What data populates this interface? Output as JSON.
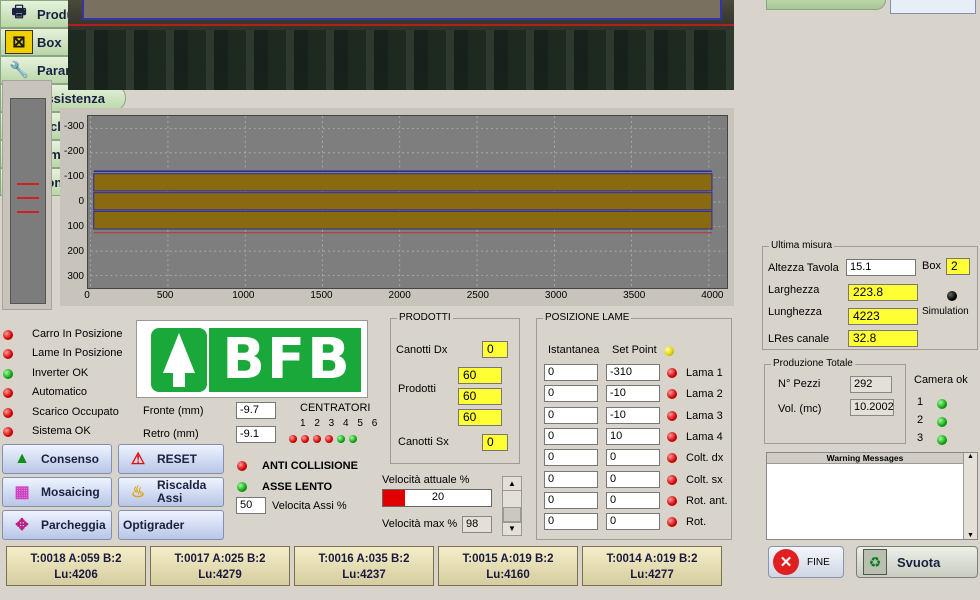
{
  "menu": [
    {
      "label": "Produzione",
      "icon": "printer-icon"
    },
    {
      "label": "Box",
      "icon": "box-icon"
    },
    {
      "label": "Parametri",
      "icon": "wrench-icon"
    },
    {
      "label": "Assistenza",
      "icon": "computer-icon"
    },
    {
      "label": "Ciclo",
      "icon": "list-icon"
    },
    {
      "label": "Simulazione",
      "icon": "ruler-icon"
    },
    {
      "label": "Controllo",
      "icon": "camera-icon"
    }
  ],
  "plot": {
    "y_ticks": [
      "-300",
      "-200",
      "-100",
      "0",
      "100",
      "200",
      "300"
    ],
    "x_ticks": [
      "0",
      "500",
      "1000",
      "1500",
      "2000",
      "2500",
      "3000",
      "3500",
      "4000"
    ],
    "colors": {
      "background": "#7e7e7e",
      "board": "#8a6a10",
      "outline": "#2a2a9a"
    }
  },
  "status_leds": [
    {
      "label": "Carro In Posizione",
      "state": "red"
    },
    {
      "label": "Lame In Posizione",
      "state": "red"
    },
    {
      "label": "Inverter OK",
      "state": "green"
    },
    {
      "label": "Automatico",
      "state": "red"
    },
    {
      "label": "Scarico Occupato",
      "state": "red"
    },
    {
      "label": "Sistema OK",
      "state": "red"
    }
  ],
  "logo": {
    "text": "BFB",
    "color": "#1aa83a"
  },
  "fronte": {
    "label": "Fronte (mm)",
    "value": "-9.7"
  },
  "retro": {
    "label": "Retro (mm)",
    "value": "-9.1"
  },
  "centratori": {
    "label": "CENTRATORI",
    "numbers": "1 2 3 4 5 6",
    "states": [
      "red",
      "red",
      "red",
      "red",
      "green",
      "green"
    ]
  },
  "buttons": {
    "consenso": "Consenso",
    "reset": "RESET",
    "mosaicing": "Mosaicing",
    "riscalda": "Riscalda Assi",
    "parcheggia": "Parcheggia",
    "optigrader": "Optigrader"
  },
  "anti_collisione": "ANTI COLLISIONE",
  "asse_lento": "ASSE LENTO",
  "velocita_assi": {
    "value": "50",
    "label": "Velocita Assi %"
  },
  "prodotti": {
    "title": "PRODOTTI",
    "canotti_dx_label": "Canotti Dx",
    "canotti_dx": "0",
    "prodotti_label": "Prodotti",
    "values": [
      "60",
      "60",
      "60"
    ],
    "canotti_sx_label": "Canotti Sx",
    "canotti_sx": "0"
  },
  "velocita": {
    "attuale_label": "Velocità attuale %",
    "attuale": "20",
    "attuale_fraction": 0.2,
    "max_label": "Velocità max %",
    "max": "98"
  },
  "posizione_lame": {
    "title": "POSIZIONE LAME",
    "col_istantanea": "Istantanea",
    "col_setpoint": "Set Point",
    "rows": [
      {
        "label": "Lama 1",
        "ist": "0",
        "sp": "-310"
      },
      {
        "label": "Lama 2",
        "ist": "0",
        "sp": "-10"
      },
      {
        "label": "Lama 3",
        "ist": "0",
        "sp": "-10"
      },
      {
        "label": "Lama 4",
        "ist": "0",
        "sp": "10"
      },
      {
        "label": "Colt. dx",
        "ist": "0",
        "sp": "0"
      },
      {
        "label": "Colt. sx",
        "ist": "0",
        "sp": "0"
      },
      {
        "label": "Rot. ant.",
        "ist": "0",
        "sp": "0"
      },
      {
        "label": "Rot.",
        "ist": "0",
        "sp": "0"
      }
    ]
  },
  "ultima_misura": {
    "title": "Ultima misura",
    "altezza_label": "Altezza Tavola",
    "altezza": "15.1",
    "box_label": "Box",
    "box": "2",
    "larghezza_label": "Larghezza",
    "larghezza": "223.8",
    "lunghezza_label": "Lunghezza",
    "lunghezza": "4223",
    "lres_label": "LRes canale",
    "lres": "32.8",
    "simulation_label": "Simulation"
  },
  "produzione_totale": {
    "title": "Produzione Totale",
    "pezzi_label": "N° Pezzi",
    "pezzi": "292",
    "vol_label": "Vol. (mc)",
    "vol": "10.2002"
  },
  "camera": {
    "title": "Camera ok",
    "items": [
      "1",
      "2",
      "3"
    ]
  },
  "warning": {
    "title": "Warning Messages"
  },
  "bottom_status": [
    {
      "l1": "T:0018 A:059 B:2",
      "l2": "Lu:4206"
    },
    {
      "l1": "T:0017 A:025 B:2",
      "l2": "Lu:4279"
    },
    {
      "l1": "T:0016 A:035 B:2",
      "l2": "Lu:4237"
    },
    {
      "l1": "T:0015 A:019 B:2",
      "l2": "Lu:4160"
    },
    {
      "l1": "T:0014 A:019 B:2",
      "l2": "Lu:4277"
    }
  ],
  "fine_label": "FINE",
  "svuota_label": "Svuota"
}
